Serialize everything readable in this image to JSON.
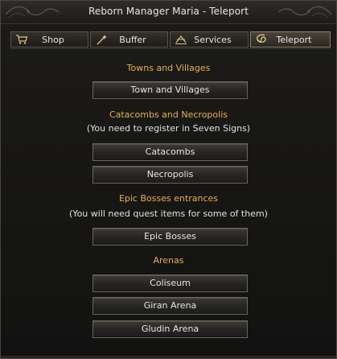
{
  "window": {
    "title": "Reborn Manager Maria - Teleport"
  },
  "tabs": [
    {
      "label": "Shop",
      "icon": "cart-icon"
    },
    {
      "label": "Buffer",
      "icon": "wand-icon"
    },
    {
      "label": "Services",
      "icon": "services-icon"
    },
    {
      "label": "Teleport",
      "icon": "teleport-swirl-icon",
      "active": true
    }
  ],
  "sections": {
    "towns": {
      "heading": "Towns and Villages",
      "buttons": [
        "Town and Villages"
      ]
    },
    "catacombs": {
      "heading": "Catacombs and Necropolis",
      "note": "(You need to register in Seven Signs)",
      "buttons": [
        "Catacombs",
        "Necropolis"
      ]
    },
    "epic": {
      "heading": "Epic Bosses entrances",
      "note": "(You will need quest items for some of them)",
      "buttons": [
        "Epic Bosses"
      ]
    },
    "arenas": {
      "heading": "Arenas",
      "buttons": [
        "Coliseum",
        "Giran Arena",
        "Gludin Arena"
      ]
    }
  },
  "colors": {
    "heading": "#e8b04b",
    "text": "#e6e6e6",
    "background": "#161514"
  }
}
